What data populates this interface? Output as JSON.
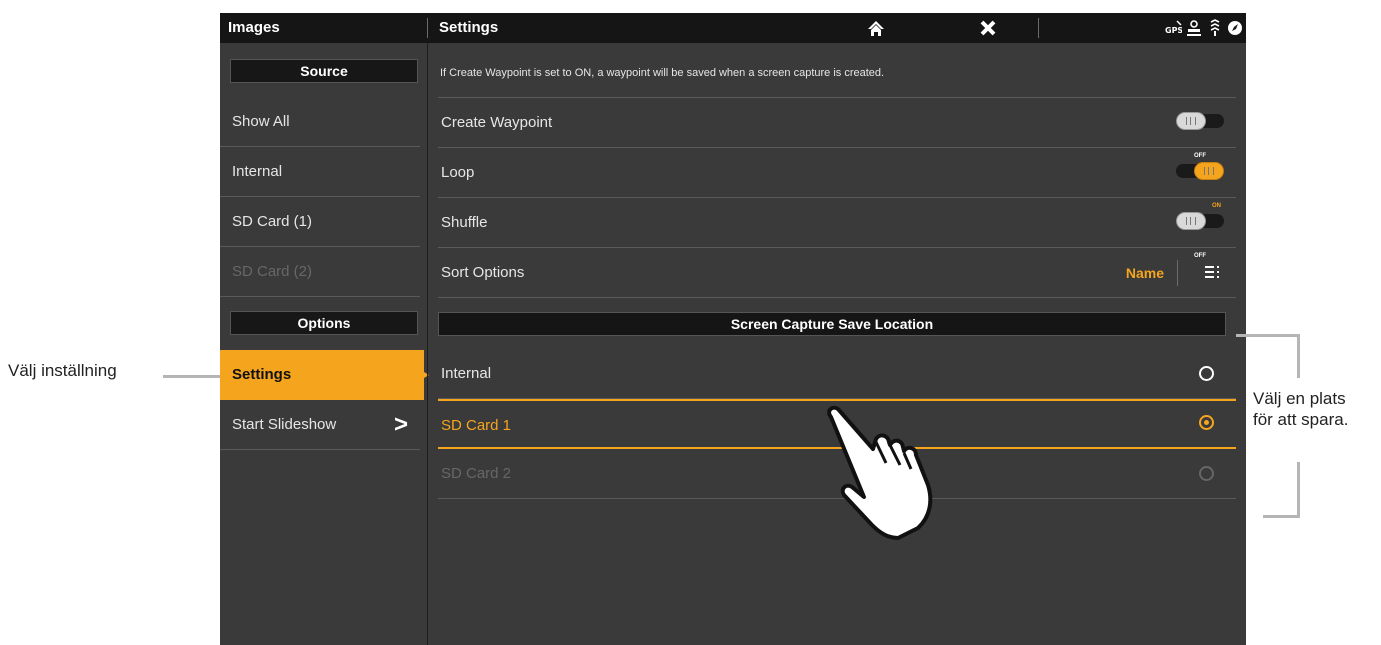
{
  "topbar": {
    "left_title": "Images",
    "right_title": "Settings",
    "icons": [
      "home-icon",
      "close-icon",
      "gps-icon",
      "person-icon",
      "sonar-icon",
      "compass-icon"
    ]
  },
  "sidebar": {
    "source_header": "Source",
    "items": [
      {
        "label": "Show All"
      },
      {
        "label": "Internal"
      },
      {
        "label": "SD Card (1)"
      },
      {
        "label": "SD Card (2)"
      }
    ],
    "options_header": "Options",
    "options": [
      {
        "label": "Settings"
      },
      {
        "label": "Start Slideshow"
      }
    ]
  },
  "settings": {
    "info": "If Create Waypoint is set to ON, a waypoint will be saved when a screen capture is created.",
    "create_waypoint": {
      "label": "Create Waypoint",
      "state": "OFF"
    },
    "loop": {
      "label": "Loop",
      "state": "ON"
    },
    "shuffle": {
      "label": "Shuffle",
      "state": "OFF"
    },
    "sort": {
      "label": "Sort Options",
      "value": "Name"
    },
    "save_location_header": "Screen Capture Save Location",
    "locations": [
      {
        "label": "Internal"
      },
      {
        "label": "SD Card 1"
      },
      {
        "label": "SD Card 2"
      }
    ]
  },
  "callouts": {
    "left": "Välj inställning",
    "right_line1": "Välj en plats",
    "right_line2": "för att spara."
  },
  "colors": {
    "accent": "#f5a51d",
    "background": "#3a3a3a",
    "bar": "#151515"
  }
}
